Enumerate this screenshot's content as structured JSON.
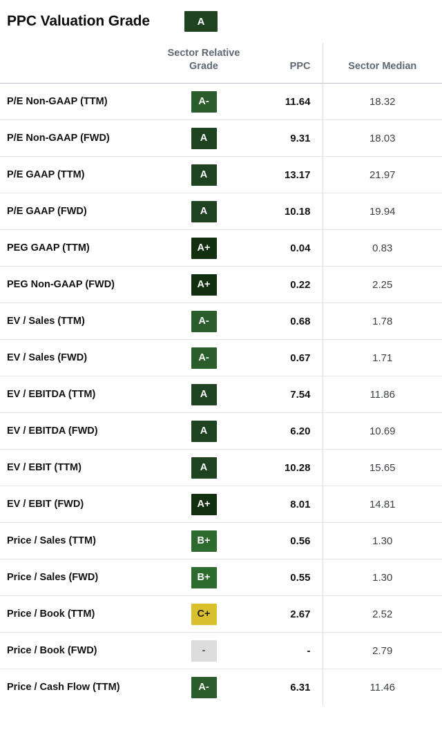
{
  "header": {
    "title": "PPC Valuation Grade",
    "overall_grade": "A",
    "overall_grade_color": "#1f4220"
  },
  "table": {
    "columns": {
      "metric": "",
      "sector_relative_grade": "Sector Relative Grade",
      "ppc": "PPC",
      "sector_median": "Sector Median"
    },
    "rows": [
      {
        "metric": "P/E Non-GAAP (TTM)",
        "grade": "A-",
        "ppc": "11.64",
        "sector_median": "18.32"
      },
      {
        "metric": "P/E Non-GAAP (FWD)",
        "grade": "A",
        "ppc": "9.31",
        "sector_median": "18.03"
      },
      {
        "metric": "P/E GAAP (TTM)",
        "grade": "A",
        "ppc": "13.17",
        "sector_median": "21.97"
      },
      {
        "metric": "P/E GAAP (FWD)",
        "grade": "A",
        "ppc": "10.18",
        "sector_median": "19.94"
      },
      {
        "metric": "PEG GAAP (TTM)",
        "grade": "A+",
        "ppc": "0.04",
        "sector_median": "0.83"
      },
      {
        "metric": "PEG Non-GAAP (FWD)",
        "grade": "A+",
        "ppc": "0.22",
        "sector_median": "2.25"
      },
      {
        "metric": "EV / Sales (TTM)",
        "grade": "A-",
        "ppc": "0.68",
        "sector_median": "1.78"
      },
      {
        "metric": "EV / Sales (FWD)",
        "grade": "A-",
        "ppc": "0.67",
        "sector_median": "1.71"
      },
      {
        "metric": "EV / EBITDA (TTM)",
        "grade": "A",
        "ppc": "7.54",
        "sector_median": "11.86"
      },
      {
        "metric": "EV / EBITDA (FWD)",
        "grade": "A",
        "ppc": "6.20",
        "sector_median": "10.69"
      },
      {
        "metric": "EV / EBIT (TTM)",
        "grade": "A",
        "ppc": "10.28",
        "sector_median": "15.65"
      },
      {
        "metric": "EV / EBIT (FWD)",
        "grade": "A+",
        "ppc": "8.01",
        "sector_median": "14.81"
      },
      {
        "metric": "Price / Sales (TTM)",
        "grade": "B+",
        "ppc": "0.56",
        "sector_median": "1.30"
      },
      {
        "metric": "Price / Sales (FWD)",
        "grade": "B+",
        "ppc": "0.55",
        "sector_median": "1.30"
      },
      {
        "metric": "Price / Book (TTM)",
        "grade": "C+",
        "ppc": "2.67",
        "sector_median": "2.52"
      },
      {
        "metric": "Price / Book (FWD)",
        "grade": "-",
        "ppc": "-",
        "sector_median": "2.79"
      },
      {
        "metric": "Price / Cash Flow (TTM)",
        "grade": "A-",
        "ppc": "6.31",
        "sector_median": "11.46"
      }
    ]
  },
  "grade_colors": {
    "A+": "#12300f",
    "A": "#1f4220",
    "A-": "#2b5c2c",
    "B+": "#2d6a2d",
    "C+": "#dbc02e",
    "-": "#dcdcdc"
  }
}
